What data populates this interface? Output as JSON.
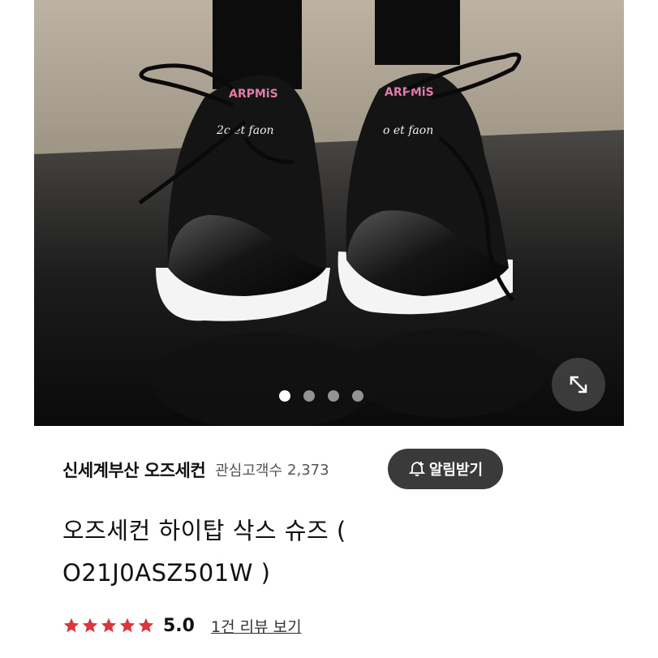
{
  "product_image": {
    "alt": "shoe-photo",
    "carousel": {
      "total": 4,
      "active_index": 0
    }
  },
  "store": {
    "name": "신세계부산 오즈세컨",
    "fans_label": "관심고객수",
    "fans_count": "2,373",
    "notify_label": "알림받기"
  },
  "product": {
    "title_line1": "오즈세컨 하이탑 삭스 슈즈 (",
    "title_line2": "O21J0ASZ501W )"
  },
  "rating": {
    "stars": 5,
    "value": "5.0",
    "review_link": "1건 리뷰 보기",
    "star_color": "#d9363e"
  },
  "icons": {
    "expand": "expand-arrows-icon",
    "notify": "bell-plus-icon",
    "star": "star-icon"
  }
}
